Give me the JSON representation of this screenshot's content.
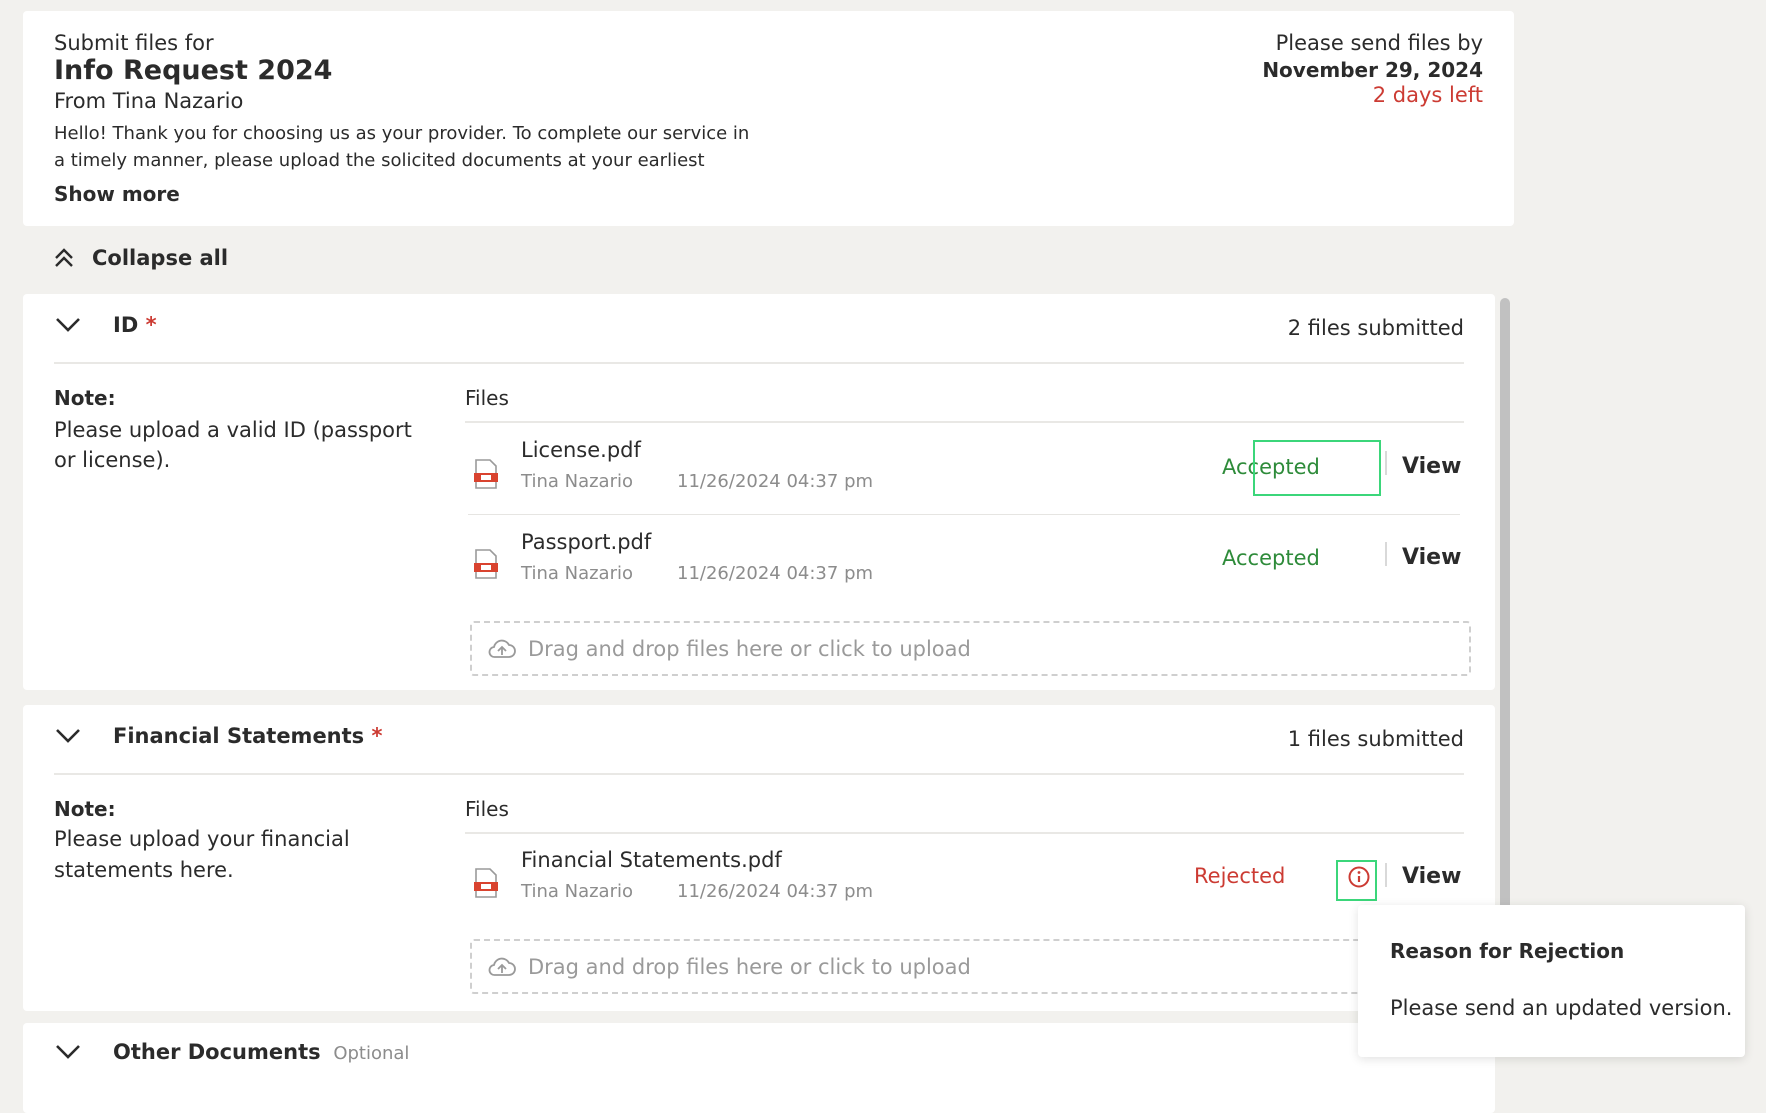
{
  "header": {
    "submit_for": "Submit files for",
    "title": "Info Request 2024",
    "from": "From Tina Nazario",
    "message_line1": "Hello! Thank you for choosing us as your provider. To complete our service in",
    "message_line2": "a timely manner, please upload the solicited documents at your earliest",
    "show_more": "Show more",
    "send_by_label": "Please send files by",
    "due_date": "November 29, 2024",
    "days_left": "2 days left"
  },
  "collapse_all": "Collapse all",
  "sections": [
    {
      "title": "ID",
      "required_mark": "*",
      "count": "2 files submitted",
      "note_label": "Note:",
      "note_line1": "Please upload a valid ID (passport",
      "note_line2": "or license).",
      "files_label": "Files",
      "files": [
        {
          "name": "License.pdf",
          "author": "Tina Nazario",
          "date": "11/26/2024 04:37 pm",
          "status": "Accepted",
          "view": "View"
        },
        {
          "name": "Passport.pdf",
          "author": "Tina Nazario",
          "date": "11/26/2024 04:37 pm",
          "status": "Accepted",
          "view": "View"
        }
      ],
      "upload": "Drag and drop files here or click to upload"
    },
    {
      "title": "Financial Statements",
      "required_mark": "*",
      "count": "1 files submitted",
      "note_label": "Note:",
      "note_line1": "Please upload your financial",
      "note_line2": "statements here.",
      "files_label": "Files",
      "files": [
        {
          "name": "Financial Statements.pdf",
          "author": "Tina Nazario",
          "date": "11/26/2024 04:37 pm",
          "status": "Rejected",
          "view": "View"
        }
      ],
      "upload": "Drag and drop files here or click to upload"
    },
    {
      "title": "Other Documents",
      "optional": "Optional"
    }
  ],
  "tooltip": {
    "title": "Reason for Rejection",
    "text": "Please send an updated version."
  },
  "colors": {
    "accepted": "#2e8b3a",
    "rejected": "#cc3b33",
    "highlight": "#3bd67a",
    "background": "#f2f1ee"
  }
}
